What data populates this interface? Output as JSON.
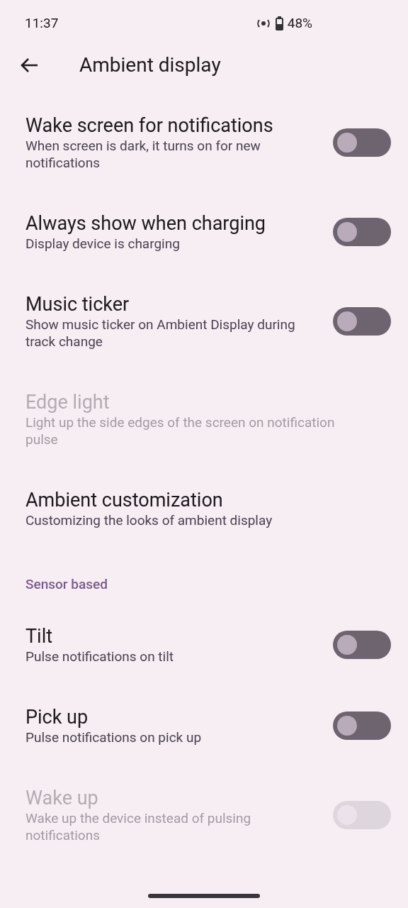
{
  "status_bar": {
    "time": "11:37",
    "battery": "48%"
  },
  "header": {
    "title": "Ambient display"
  },
  "items": [
    {
      "kind": "switch",
      "title": "Wake screen for notifications",
      "subtitle": "When screen is dark, it turns on for new notifications",
      "on": false,
      "disabled": false
    },
    {
      "kind": "switch",
      "title": "Always show when charging",
      "subtitle": "Display device is charging",
      "on": false,
      "disabled": false
    },
    {
      "kind": "switch",
      "title": "Music ticker",
      "subtitle": "Show music ticker on Ambient Display during track change",
      "on": false,
      "disabled": false
    },
    {
      "kind": "link",
      "title": "Edge light",
      "subtitle": "Light up the side edges of the screen on notification pulse",
      "disabled": true
    },
    {
      "kind": "link",
      "title": "Ambient customization",
      "subtitle": "Customizing the looks of ambient display",
      "disabled": false
    },
    {
      "kind": "section",
      "title": "Sensor based"
    },
    {
      "kind": "switch",
      "title": "Tilt",
      "subtitle": "Pulse notifications on tilt",
      "on": false,
      "disabled": false
    },
    {
      "kind": "switch",
      "title": "Pick up",
      "subtitle": "Pulse notifications on pick up",
      "on": false,
      "disabled": false
    },
    {
      "kind": "switch",
      "title": "Wake up",
      "subtitle": "Wake up the device instead of pulsing notifications",
      "on": false,
      "disabled": true
    }
  ]
}
